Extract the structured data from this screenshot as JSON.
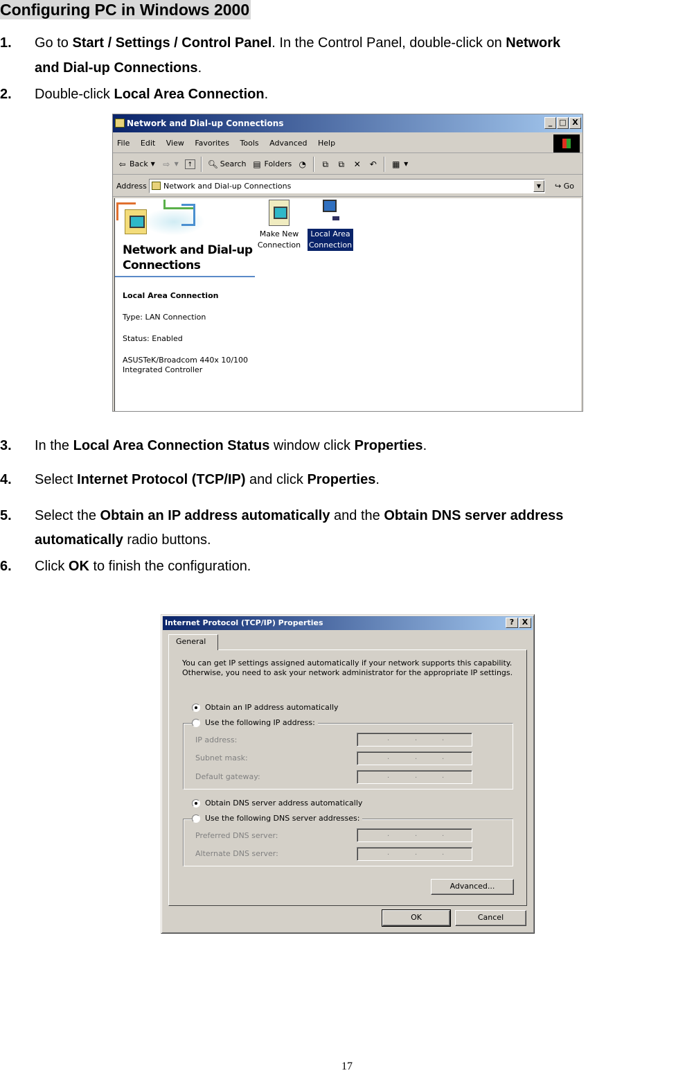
{
  "heading": "Configuring PC in Windows 2000",
  "steps": [
    {
      "num": "1.",
      "line1": [
        {
          "t": "Go to ",
          "b": false
        },
        {
          "t": "Start / Settings / Control Panel",
          "b": true
        },
        {
          "t": ". In the Control Panel, double-click on ",
          "b": false
        },
        {
          "t": "Network",
          "b": true
        }
      ],
      "line2": [
        {
          "t": "and Dial-up Connections",
          "b": true
        },
        {
          "t": ".",
          "b": false
        }
      ]
    },
    {
      "num": "2.",
      "line1": [
        {
          "t": "Double-click ",
          "b": false
        },
        {
          "t": "Local Area Connection",
          "b": true
        },
        {
          "t": ".",
          "b": false
        }
      ]
    },
    {
      "num": "3.",
      "line1": [
        {
          "t": "In the ",
          "b": false
        },
        {
          "t": "Local Area Connection Status",
          "b": true
        },
        {
          "t": " window click ",
          "b": false
        },
        {
          "t": "Properties",
          "b": true
        },
        {
          "t": ".",
          "b": false
        }
      ]
    },
    {
      "num": "4.",
      "line1": [
        {
          "t": "Select ",
          "b": false
        },
        {
          "t": "Internet Protocol (TCP/IP)",
          "b": true
        },
        {
          "t": " and click ",
          "b": false
        },
        {
          "t": "Properties",
          "b": true
        },
        {
          "t": ".",
          "b": false
        }
      ]
    },
    {
      "num": "5.",
      "line1": [
        {
          "t": "Select the ",
          "b": false
        },
        {
          "t": "Obtain an IP address automatically",
          "b": true
        },
        {
          "t": " and the ",
          "b": false
        },
        {
          "t": "Obtain DNS server address",
          "b": true
        }
      ],
      "line2": [
        {
          "t": "automatically",
          "b": true
        },
        {
          "t": " radio buttons.",
          "b": false
        }
      ]
    },
    {
      "num": "6.",
      "line1": [
        {
          "t": "Click ",
          "b": false
        },
        {
          "t": "OK",
          "b": true
        },
        {
          "t": " to finish the configuration.",
          "b": false
        }
      ]
    }
  ],
  "window1": {
    "title": "Network and Dial-up Connections",
    "caption_buttons": [
      "_",
      "□",
      "X"
    ],
    "menu": [
      "File",
      "Edit",
      "View",
      "Favorites",
      "Tools",
      "Advanced",
      "Help"
    ],
    "toolbar": {
      "back": "Back",
      "search": "Search",
      "folders": "Folders"
    },
    "address_label": "Address",
    "address_value": "Network and Dial-up Connections",
    "go_label": "Go",
    "banner_title": "Network and Dial-up Connections",
    "details": {
      "title": "Local Area Connection",
      "type": "Type: LAN Connection",
      "status": "Status: Enabled",
      "device_line1": "ASUSTeK/Broadcom 440x 10/100",
      "device_line2": "Integrated Controller"
    },
    "icons": [
      {
        "line1": "Make New",
        "line2": "Connection",
        "selected": false
      },
      {
        "line1": "Local Area",
        "line2": "Connection",
        "selected": true
      }
    ]
  },
  "window2": {
    "title": "Internet Protocol (TCP/IP) Properties",
    "caption_buttons": [
      "?",
      "X"
    ],
    "tab": "General",
    "intro": "You can get IP settings assigned automatically if your network supports this capability. Otherwise, you need to ask your network administrator for the appropriate IP settings.",
    "ip_auto": {
      "label": "Obtain an IP address automatically",
      "selected": true
    },
    "ip_manual": {
      "label": "Use the following IP address:",
      "selected": false
    },
    "ip_fields": [
      {
        "label": "IP address:",
        "value": ". . ."
      },
      {
        "label": "Subnet mask:",
        "value": ". . ."
      },
      {
        "label": "Default gateway:",
        "value": ". . ."
      }
    ],
    "dns_auto": {
      "label": "Obtain DNS server address automatically",
      "selected": true
    },
    "dns_manual": {
      "label": "Use the following DNS server addresses:",
      "selected": false
    },
    "dns_fields": [
      {
        "label": "Preferred DNS server:",
        "value": ". . ."
      },
      {
        "label": "Alternate DNS server:",
        "value": ". . ."
      }
    ],
    "advanced_button": "Advanced...",
    "ok_button": "OK",
    "cancel_button": "Cancel"
  },
  "page_number": "17"
}
